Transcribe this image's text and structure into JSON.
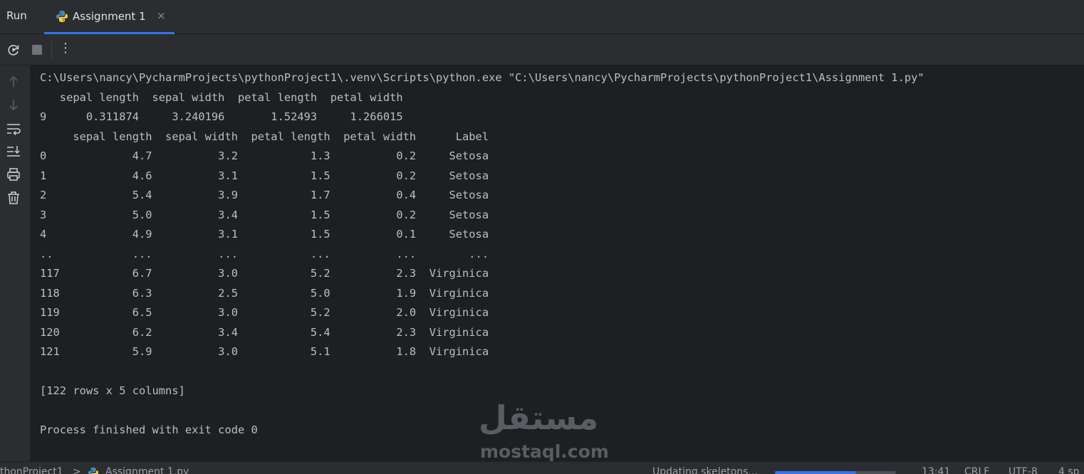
{
  "header": {
    "panel_title": "Run",
    "tab": {
      "label": "Assignment 1",
      "icon": "python-icon",
      "close": "×"
    }
  },
  "toolbar": {
    "rerun_icon": "rerun-icon",
    "stop_icon": "stop-icon",
    "more_label": "⋮"
  },
  "sidebar": {
    "icons": [
      "arrow-up-icon",
      "arrow-down-icon",
      "soft-wrap-icon",
      "scroll-to-end-icon",
      "print-icon",
      "trash-icon"
    ]
  },
  "console": {
    "lines": [
      "C:\\Users\\nancy\\PycharmProjects\\pythonProject1\\.venv\\Scripts\\python.exe \"C:\\Users\\nancy\\PycharmProjects\\pythonProject1\\Assignment 1.py\"",
      "   sepal length  sepal width  petal length  petal width",
      "9      0.311874     3.240196       1.52493     1.266015",
      "     sepal length  sepal width  petal length  petal width      Label",
      "0             4.7          3.2           1.3          0.2     Setosa",
      "1             4.6          3.1           1.5          0.2     Setosa",
      "2             5.4          3.9           1.7          0.4     Setosa",
      "3             5.0          3.4           1.5          0.2     Setosa",
      "4             4.9          3.1           1.5          0.1     Setosa",
      "..            ...          ...           ...          ...        ...",
      "117           6.7          3.0           5.2          2.3  Virginica",
      "118           6.3          2.5           5.0          1.9  Virginica",
      "119           6.5          3.0           5.2          2.0  Virginica",
      "120           6.2          3.4           5.4          2.3  Virginica",
      "121           5.9          3.0           5.1          1.8  Virginica",
      "",
      "[122 rows x 5 columns]",
      "",
      "Process finished with exit code 0"
    ]
  },
  "watermark": {
    "arabic": "مستقل",
    "latin": "mostaql.com"
  },
  "statusbar": {
    "project": "thonProject1",
    "separator": ">",
    "file": "Assignment 1.py",
    "task": "Updating skeletons...",
    "progress": 0.67,
    "position": "13:41",
    "line_ending": "CRLF",
    "encoding": "UTF-8",
    "indent": "4 sp"
  },
  "colors": {
    "background": "#1e1f22",
    "panel": "#2b2d30",
    "text": "#bcbec4",
    "accent": "#3574f0"
  }
}
